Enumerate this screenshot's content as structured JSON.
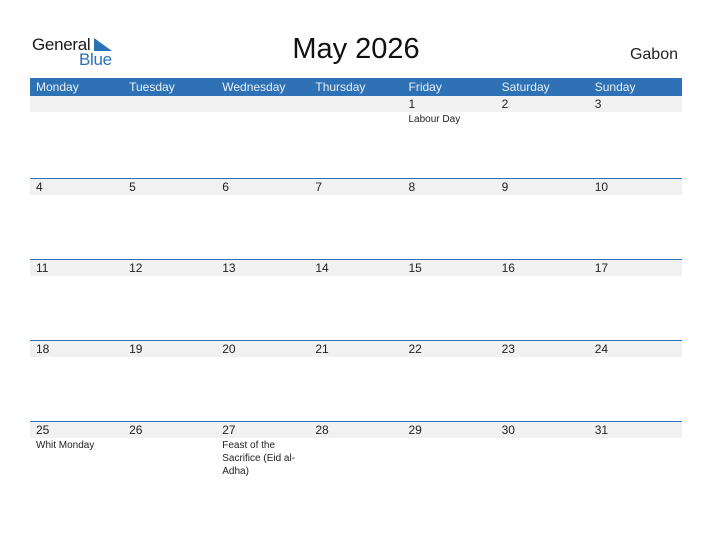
{
  "logo": {
    "line1": "General",
    "line2": "Blue"
  },
  "title": "May 2026",
  "country": "Gabon",
  "colors": {
    "accent": "#2e72b5",
    "date_strip": "#f1f1f1"
  },
  "weekdays": [
    "Monday",
    "Tuesday",
    "Wednesday",
    "Thursday",
    "Friday",
    "Saturday",
    "Sunday"
  ],
  "weeks": [
    [
      {
        "day": "",
        "event": ""
      },
      {
        "day": "",
        "event": ""
      },
      {
        "day": "",
        "event": ""
      },
      {
        "day": "",
        "event": ""
      },
      {
        "day": "1",
        "event": "Labour Day"
      },
      {
        "day": "2",
        "event": ""
      },
      {
        "day": "3",
        "event": ""
      }
    ],
    [
      {
        "day": "4",
        "event": ""
      },
      {
        "day": "5",
        "event": ""
      },
      {
        "day": "6",
        "event": ""
      },
      {
        "day": "7",
        "event": ""
      },
      {
        "day": "8",
        "event": ""
      },
      {
        "day": "9",
        "event": ""
      },
      {
        "day": "10",
        "event": ""
      }
    ],
    [
      {
        "day": "11",
        "event": ""
      },
      {
        "day": "12",
        "event": ""
      },
      {
        "day": "13",
        "event": ""
      },
      {
        "day": "14",
        "event": ""
      },
      {
        "day": "15",
        "event": ""
      },
      {
        "day": "16",
        "event": ""
      },
      {
        "day": "17",
        "event": ""
      }
    ],
    [
      {
        "day": "18",
        "event": ""
      },
      {
        "day": "19",
        "event": ""
      },
      {
        "day": "20",
        "event": ""
      },
      {
        "day": "21",
        "event": ""
      },
      {
        "day": "22",
        "event": ""
      },
      {
        "day": "23",
        "event": ""
      },
      {
        "day": "24",
        "event": ""
      }
    ],
    [
      {
        "day": "25",
        "event": "Whit Monday"
      },
      {
        "day": "26",
        "event": ""
      },
      {
        "day": "27",
        "event": "Feast of the Sacrifice (Eid al-Adha)"
      },
      {
        "day": "28",
        "event": ""
      },
      {
        "day": "29",
        "event": ""
      },
      {
        "day": "30",
        "event": ""
      },
      {
        "day": "31",
        "event": ""
      }
    ]
  ]
}
